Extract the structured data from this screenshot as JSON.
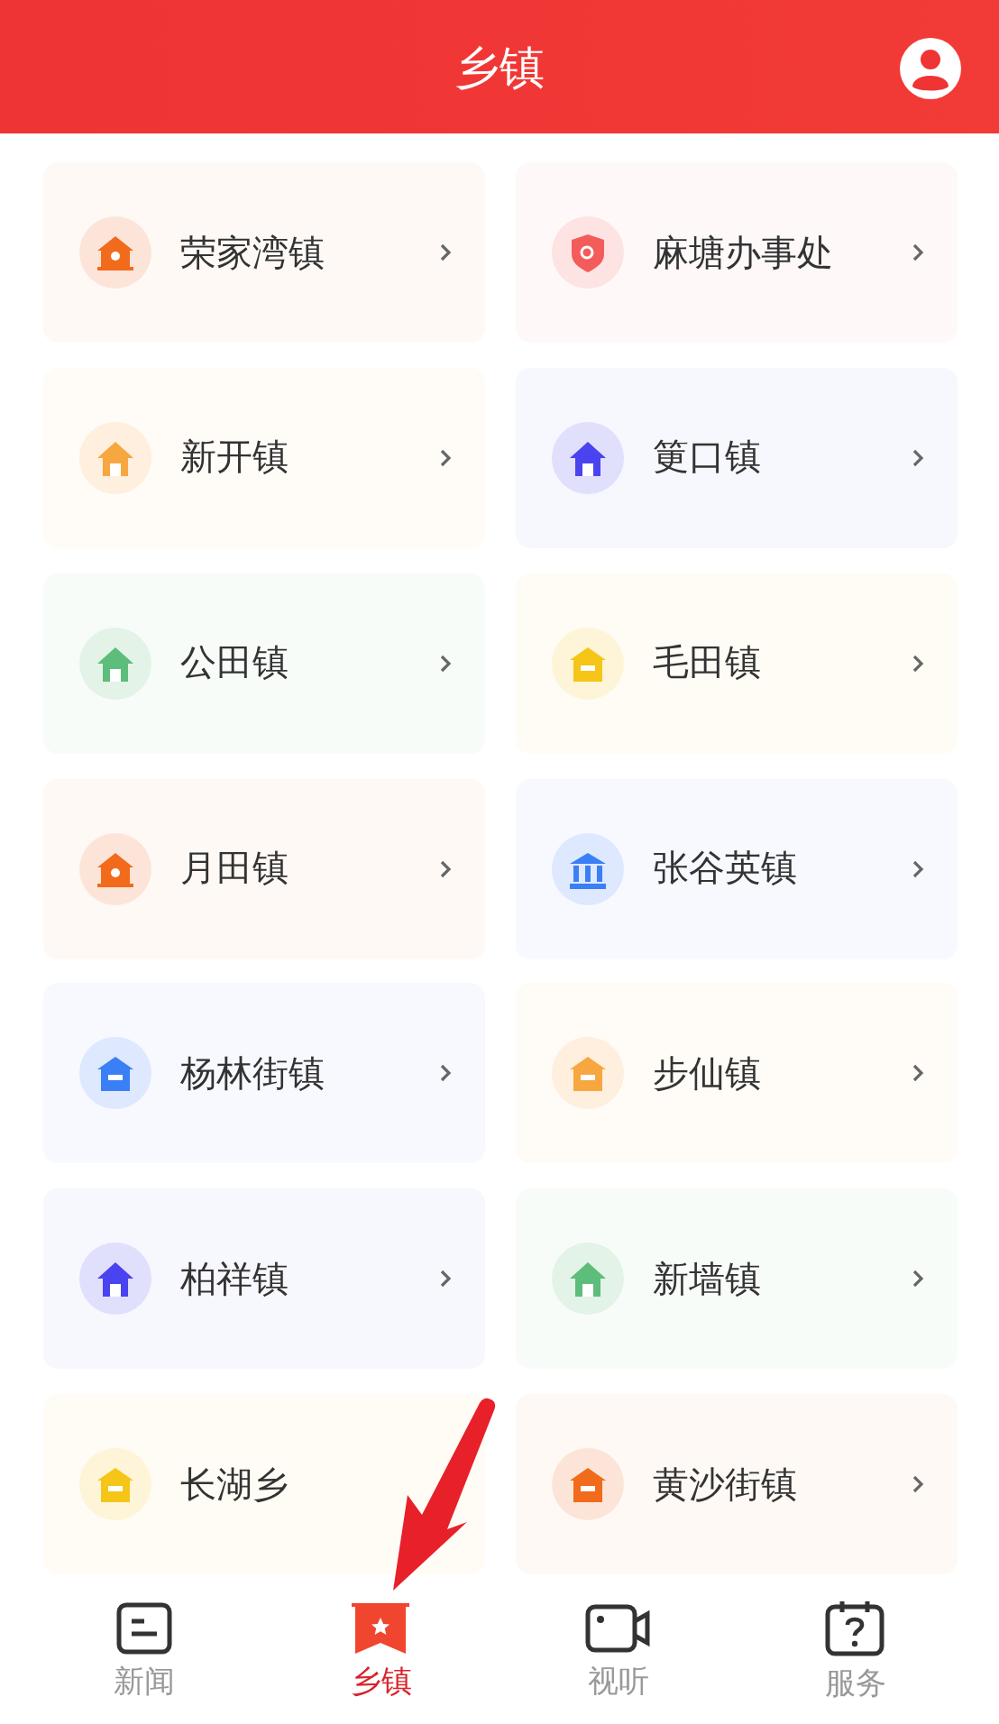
{
  "header": {
    "title": "乡镇"
  },
  "towns": [
    {
      "name": "荣家湾镇",
      "color": "#f26a1b",
      "kind": "hall",
      "chevron": true
    },
    {
      "name": "麻塘办事处",
      "color": "#f45b5b",
      "kind": "shield",
      "chevron": true
    },
    {
      "name": "新开镇",
      "color": "#f7a73f",
      "kind": "house",
      "chevron": true
    },
    {
      "name": "筻口镇",
      "color": "#4a43f0",
      "kind": "house",
      "chevron": true
    },
    {
      "name": "公田镇",
      "color": "#5dbd7a",
      "kind": "house",
      "chevron": true
    },
    {
      "name": "毛田镇",
      "color": "#f5c518",
      "kind": "shop",
      "chevron": true
    },
    {
      "name": "月田镇",
      "color": "#f26a1b",
      "kind": "hall",
      "chevron": true
    },
    {
      "name": "张谷英镇",
      "color": "#3a7ff5",
      "kind": "bank",
      "chevron": true
    },
    {
      "name": "杨林街镇",
      "color": "#3a7ff5",
      "kind": "shop",
      "chevron": true
    },
    {
      "name": "步仙镇",
      "color": "#f7a73f",
      "kind": "shop",
      "chevron": true
    },
    {
      "name": "柏祥镇",
      "color": "#4a43f0",
      "kind": "house",
      "chevron": true
    },
    {
      "name": "新墙镇",
      "color": "#5dbd7a",
      "kind": "house",
      "chevron": true
    },
    {
      "name": "长湖乡",
      "color": "#f5c518",
      "kind": "shop",
      "chevron": false
    },
    {
      "name": "黄沙街镇",
      "color": "#f26a1b",
      "kind": "shop",
      "chevron": true
    }
  ],
  "tabs": [
    {
      "label": "新闻",
      "kind": "news",
      "selected": false
    },
    {
      "label": "乡镇",
      "kind": "town",
      "selected": true
    },
    {
      "label": "视听",
      "kind": "video",
      "selected": false
    },
    {
      "label": "服务",
      "kind": "service",
      "selected": false
    }
  ]
}
